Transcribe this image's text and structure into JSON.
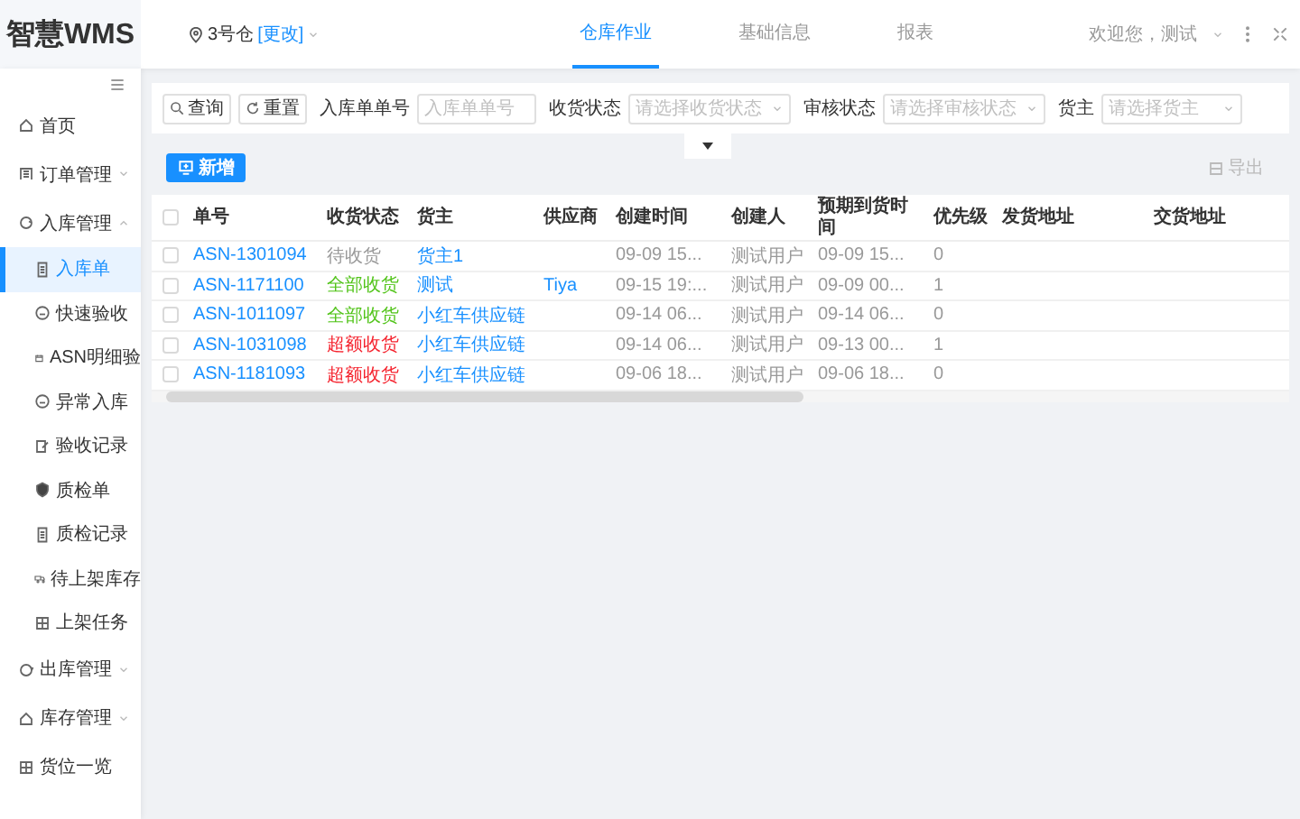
{
  "header": {
    "logo": "智慧WMS",
    "warehouse": "3号仓",
    "change_link": "[更改]",
    "nav": [
      {
        "label": "仓库作业",
        "selected": true
      },
      {
        "label": "基础信息",
        "selected": false
      },
      {
        "label": "报表",
        "selected": false
      }
    ],
    "welcome": "欢迎您，测试"
  },
  "sidebar": {
    "items": [
      {
        "label": "首页",
        "kind": "plain"
      },
      {
        "label": "订单管理",
        "kind": "group",
        "expanded": false
      },
      {
        "label": "入库管理",
        "kind": "group",
        "expanded": true,
        "children": [
          {
            "label": "入库单",
            "selected": true
          },
          {
            "label": "快速验收",
            "selected": false
          },
          {
            "label": "ASN明细验",
            "selected": false
          },
          {
            "label": "异常入库",
            "selected": false
          },
          {
            "label": "验收记录",
            "selected": false
          },
          {
            "label": "质检单",
            "selected": false
          },
          {
            "label": "质检记录",
            "selected": false
          },
          {
            "label": "待上架库存",
            "selected": false
          },
          {
            "label": "上架任务",
            "selected": false
          }
        ]
      },
      {
        "label": "出库管理",
        "kind": "group",
        "expanded": false
      },
      {
        "label": "库存管理",
        "kind": "group",
        "expanded": false
      },
      {
        "label": "货位一览",
        "kind": "plain"
      }
    ]
  },
  "filters": {
    "search_button": "查询",
    "reset_button": "重置",
    "expanded": false,
    "fields": [
      {
        "label": "入库单单号",
        "placeholder": "入库单单号",
        "kind": "text"
      },
      {
        "label": "收货状态",
        "placeholder": "请选择收货状态",
        "kind": "select"
      },
      {
        "label": "审核状态",
        "placeholder": "请选择审核状态",
        "kind": "select"
      },
      {
        "label": "货主",
        "placeholder": "请选择货主",
        "kind": "select"
      }
    ]
  },
  "toolbar": {
    "add_button": "新增",
    "export_button": "导出"
  },
  "table": {
    "header_checked": false,
    "columns": [
      "单号",
      "收货状态",
      "货主",
      "供应商",
      "创建时间",
      "创建人",
      "预期到货时间",
      "优先级",
      "发货地址",
      "交货地址"
    ],
    "rows": [
      {
        "checked": false,
        "cells": [
          "ASN-1301094",
          "待收货",
          "货主1",
          "",
          "09-09 15...",
          "测试用户",
          "09-09 15...",
          "0",
          "",
          ""
        ],
        "color": "#999999"
      },
      {
        "checked": false,
        "cells": [
          "ASN-1171100",
          "全部收货",
          "测试",
          "Tiya",
          "09-15 19:...",
          "测试用户",
          "09-09 00...",
          "1",
          "",
          ""
        ],
        "color": "#52c41a"
      },
      {
        "checked": false,
        "cells": [
          "ASN-1011097",
          "全部收货",
          "小红车供应链",
          "",
          "09-14 06...",
          "测试用户",
          "09-14 06...",
          "0",
          "",
          ""
        ],
        "color": "#52c41a"
      },
      {
        "checked": false,
        "cells": [
          "ASN-1031098",
          "超额收货",
          "小红车供应链",
          "",
          "09-14 06...",
          "测试用户",
          "09-13 00...",
          "1",
          "",
          ""
        ],
        "color": "#f5222d"
      },
      {
        "checked": false,
        "cells": [
          "ASN-1181093",
          "超额收货",
          "小红车供应链",
          "",
          "09-06 18...",
          "测试用户",
          "09-06 18...",
          "0",
          "",
          ""
        ],
        "color": "#f5222d"
      }
    ]
  }
}
